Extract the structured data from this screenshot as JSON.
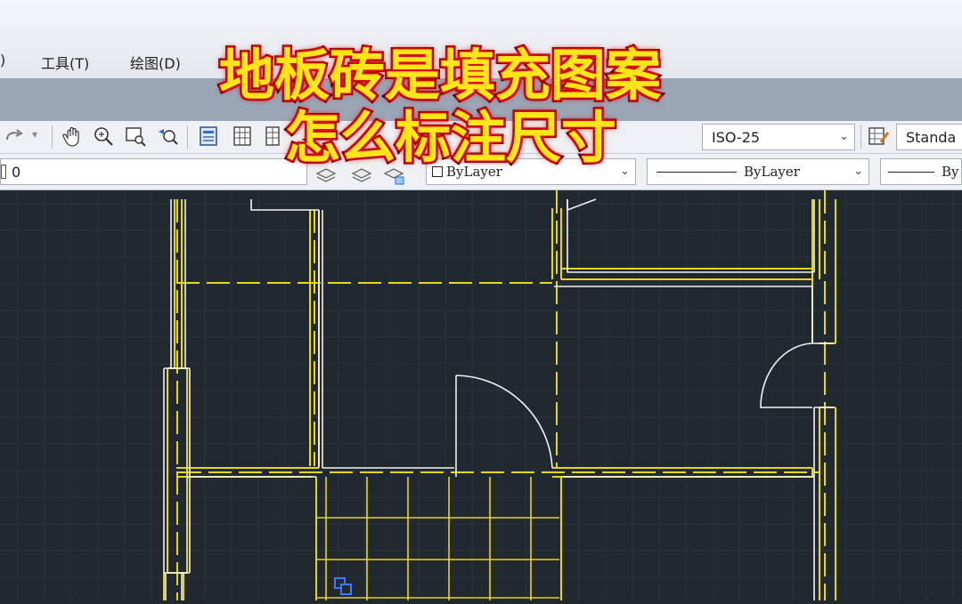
{
  "menu": {
    "partial_item": ")",
    "tools": "工具(T)",
    "draw": "绘图(D)"
  },
  "overlay_title": {
    "line1": "地板砖是填充图案",
    "line2": "怎么标注尺寸"
  },
  "toolbar": {
    "dim_style": "ISO-25",
    "text_style": "Standa",
    "layer": "0",
    "color": "ByLayer",
    "linetype": "ByLayer",
    "lineweight": "By"
  },
  "colors": {
    "wall_yellow": "#e6d61e",
    "wall_white": "#f2f2f2",
    "hatch_yellow": "#e6d61e",
    "canvas_bg": "#212830",
    "grid": "#2c3540",
    "selection_blue": "#3a7bff"
  },
  "icons": [
    "undo-icon",
    "redo-icon",
    "pan-hand-icon",
    "zoom-realtime-icon",
    "zoom-window-icon",
    "zoom-previous-icon",
    "properties-icon",
    "design-center-icon",
    "tool-palettes-icon",
    "help-icon",
    "text-style-icon",
    "layer-icon",
    "selection-grip-icon"
  ]
}
